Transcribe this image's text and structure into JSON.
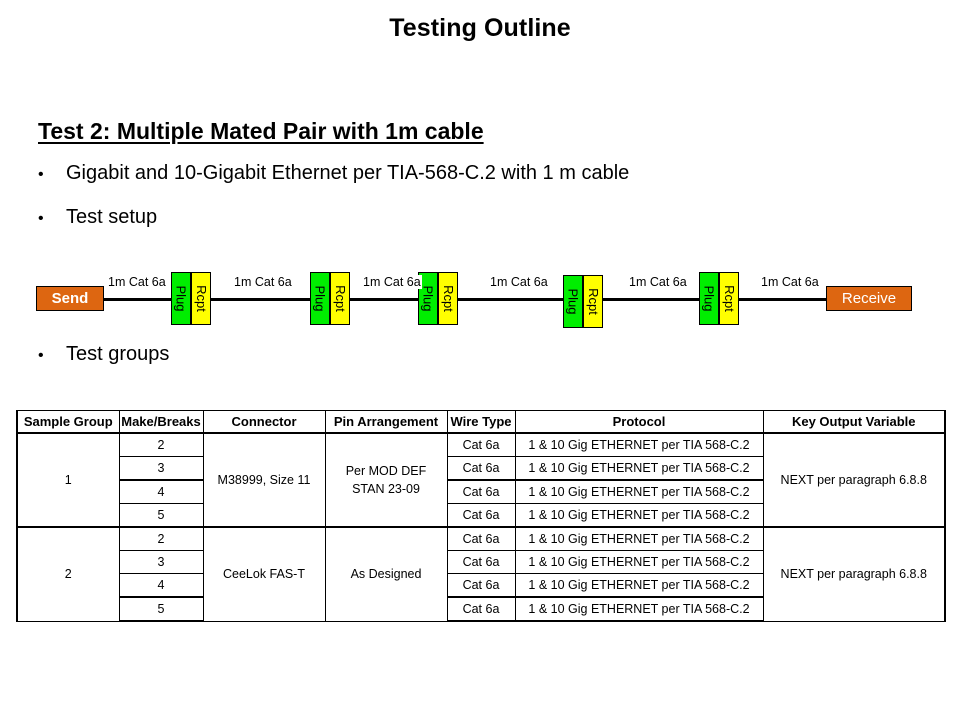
{
  "slide": {
    "title": "Testing Outline",
    "heading": "Test 2: Multiple Mated Pair with 1m cable",
    "bullet_mark": "•",
    "bullets": [
      "Gigabit and 10-Gigabit Ethernet per TIA-568-C.2 with 1 m cable",
      "Test setup",
      "Test groups"
    ]
  },
  "diagram": {
    "send_label": "Send",
    "receive_label": "Receive",
    "wire_label": "1m Cat 6a",
    "plug_label": "Plug",
    "rcpt_label": "Rcpt",
    "colors": {
      "endpoint": "#DD6611",
      "plug": "#00EE00",
      "rcpt": "#FFFF00",
      "wire": "#000000"
    },
    "wire_labels": [
      "1m Cat 6a",
      "1m Cat 6a",
      "1m Cat 6a",
      "1m Cat 6a",
      "1m Cat 6a",
      "1m Cat 6a"
    ],
    "connectors": [
      {
        "plug": "Plug",
        "rcpt": "Rcpt"
      },
      {
        "plug": "Plug",
        "rcpt": "Rcpt"
      },
      {
        "plug": "Plug",
        "rcpt": "Rcpt"
      },
      {
        "plug": "Plug",
        "rcpt": "Rcpt"
      },
      {
        "plug": "Plug",
        "rcpt": "Rcpt"
      }
    ]
  },
  "table": {
    "headers": [
      "Sample Group",
      "Make/Breaks",
      "Connector",
      "Pin Arrangement",
      "Wire Type",
      "Protocol",
      "Key Output Variable"
    ],
    "groups": [
      {
        "sample_group": "1",
        "connector": "M38999, Size 11",
        "pin_arrangement_line1": "Per MOD DEF",
        "pin_arrangement_line2": "STAN 23-09",
        "key_output_variable": "NEXT per paragraph 6.8.8",
        "rows": [
          {
            "make_breaks": "2",
            "wire_type": "Cat 6a",
            "protocol": "1 & 10 Gig ETHERNET per TIA 568-C.2"
          },
          {
            "make_breaks": "3",
            "wire_type": "Cat 6a",
            "protocol": "1 & 10 Gig ETHERNET per TIA 568-C.2"
          },
          {
            "make_breaks": "4",
            "wire_type": "Cat 6a",
            "protocol": "1 & 10 Gig ETHERNET per TIA 568-C.2"
          },
          {
            "make_breaks": "5",
            "wire_type": "Cat 6a",
            "protocol": "1 & 10 Gig ETHERNET per TIA 568-C.2"
          }
        ]
      },
      {
        "sample_group": "2",
        "connector": "CeeLok FAS-T",
        "pin_arrangement_line1": "As Designed",
        "pin_arrangement_line2": "",
        "key_output_variable": "NEXT per paragraph 6.8.8",
        "rows": [
          {
            "make_breaks": "2",
            "wire_type": "Cat 6a",
            "protocol": "1 & 10 Gig ETHERNET per TIA 568-C.2"
          },
          {
            "make_breaks": "3",
            "wire_type": "Cat 6a",
            "protocol": "1 & 10 Gig ETHERNET per TIA 568-C.2"
          },
          {
            "make_breaks": "4",
            "wire_type": "Cat 6a",
            "protocol": "1 & 10 Gig ETHERNET per TIA 568-C.2"
          },
          {
            "make_breaks": "5",
            "wire_type": "Cat 6a",
            "protocol": "1 & 10 Gig ETHERNET per TIA 568-C.2"
          }
        ]
      }
    ]
  }
}
